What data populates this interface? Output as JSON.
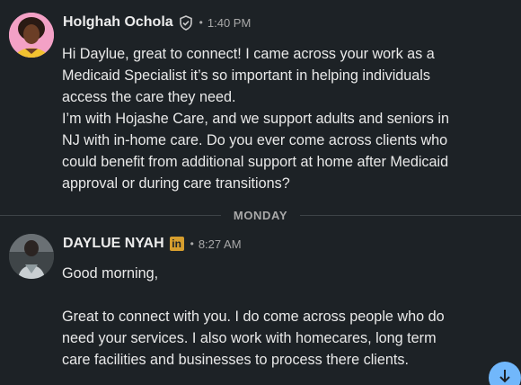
{
  "messages": [
    {
      "sender": "Holghah Ochola",
      "badge": "verified-shield-icon",
      "time": "1:40 PM",
      "paragraphs": [
        "Hi Daylue, great to connect! I came across your work as a Medicaid Specialist it’s so important in helping individuals access the care they need.",
        "I’m with Hojashe Care, and we support adults and seniors in NJ with in-home care. Do you ever come across clients who could benefit from additional support at home after Medicaid approval or during care transitions?"
      ]
    },
    {
      "sender": "DAYLUE NYAH",
      "badge": "linkedin-icon",
      "badge_text": "in",
      "time": "8:27 AM",
      "paragraphs": [
        "Good morning,",
        "Great to connect with you. I do come across people who do need your services. I also work with homecares, long term care facilities and businesses to process there clients."
      ]
    }
  ],
  "divider": {
    "label": "MONDAY"
  },
  "dot": "•",
  "colors": {
    "background": "#1d2226",
    "text": "#e9e9e9",
    "muted": "#a9a9a9",
    "linkedin_badge": "#d69e2e",
    "scroll_button": "#71b7fb"
  },
  "icons": {
    "scroll_down": "arrow-down-icon"
  }
}
